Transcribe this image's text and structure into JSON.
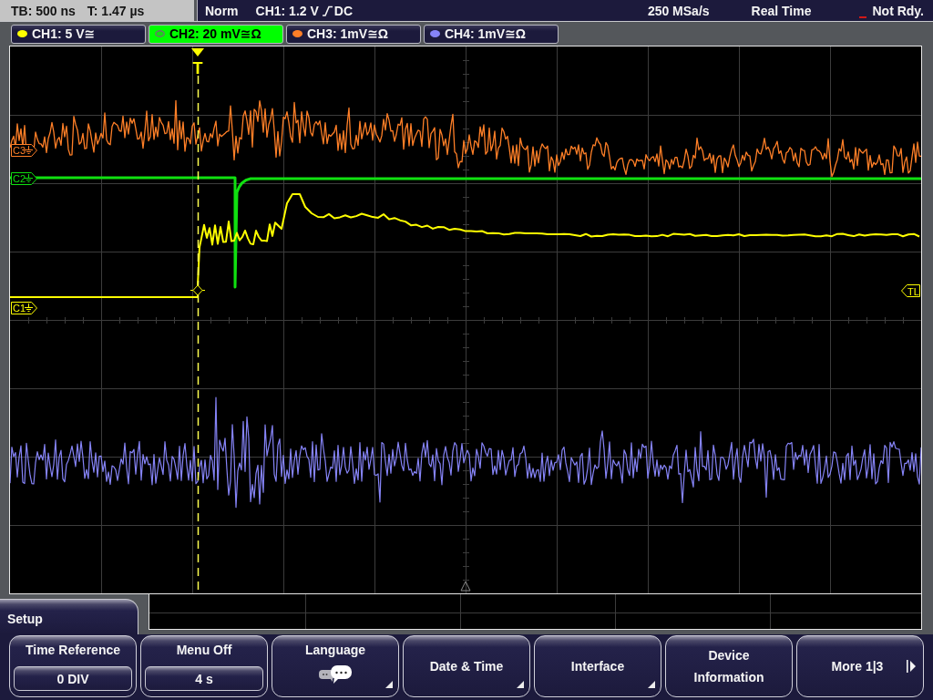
{
  "status_bar": {
    "timebase": "TB: 500 ns",
    "trigger_time": "T: 1.47 µs",
    "trigger_mode": "Norm",
    "trigger_source": "CH1: 1.2 V",
    "trigger_coupling": "DC",
    "sample_rate": "250 MSa/s",
    "acquisition_mode": "Real Time",
    "acquisition_state": "Not Rdy."
  },
  "channel_tabs": [
    {
      "label": "CH1: 5 V≅",
      "color": "#ffff00",
      "selected": false
    },
    {
      "label": "CH2: 20 mV≅Ω",
      "color": "#10e010",
      "selected": true
    },
    {
      "label": "CH3: 1mV≅Ω",
      "color": "#ff7f27",
      "selected": false
    },
    {
      "label": "CH4: 1mV≅Ω",
      "color": "#8684f8",
      "selected": false
    }
  ],
  "graticule": {
    "trigger_marker": "T",
    "channel_markers": [
      {
        "label": "C3",
        "color": "#ff7f27"
      },
      {
        "label": "C2",
        "color": "#10e010"
      },
      {
        "label": "C1",
        "color": "#ffff00"
      }
    ],
    "trigger_level_marker": "TL"
  },
  "menu": {
    "title": "Setup",
    "softkeys": [
      {
        "kind": "value",
        "label": "Time Reference",
        "value": "0 DIV"
      },
      {
        "kind": "value",
        "label": "Menu Off",
        "value": "4 s"
      },
      {
        "kind": "icon_submenu",
        "label": "Language"
      },
      {
        "kind": "submenu",
        "label": "Date & Time"
      },
      {
        "kind": "submenu",
        "label": "Interface"
      },
      {
        "kind": "plain",
        "label": "Device Information"
      },
      {
        "kind": "next",
        "label": "More 1|3"
      }
    ]
  }
}
